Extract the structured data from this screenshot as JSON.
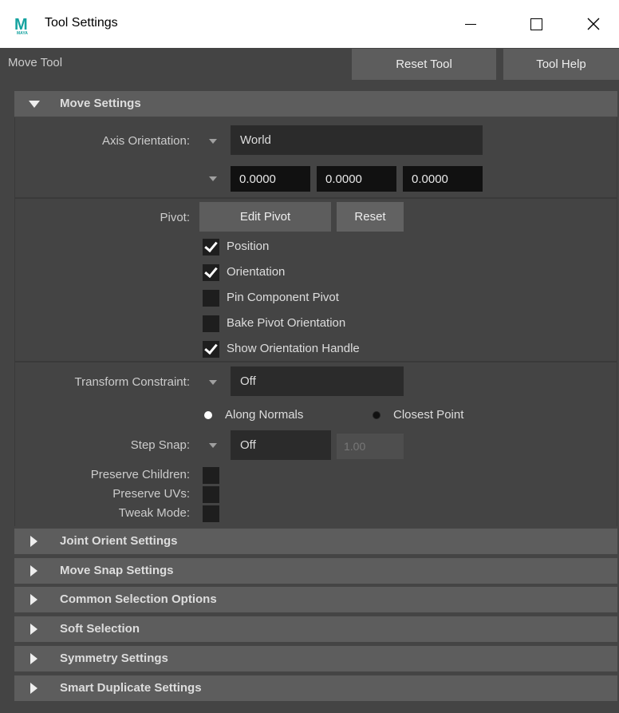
{
  "window": {
    "title": "Tool Settings",
    "logo_letter": "M",
    "logo_sub": "MAYA"
  },
  "header": {
    "tool_name": "Move Tool",
    "reset_tool": "Reset Tool",
    "tool_help": "Tool Help"
  },
  "move_settings": {
    "title": "Move Settings",
    "axis_orientation_label": "Axis Orientation:",
    "axis_orientation_value": "World",
    "axis_values": [
      "0.0000",
      "0.0000",
      "0.0000"
    ],
    "pivot_label": "Pivot:",
    "edit_pivot": "Edit Pivot",
    "reset": "Reset",
    "checks": [
      {
        "label": "Position",
        "checked": true
      },
      {
        "label": "Orientation",
        "checked": true
      },
      {
        "label": "Pin Component Pivot",
        "checked": false
      },
      {
        "label": "Bake Pivot Orientation",
        "checked": false
      },
      {
        "label": "Show Orientation Handle",
        "checked": true
      }
    ],
    "transform_constraint_label": "Transform Constraint:",
    "transform_constraint_value": "Off",
    "radio_along_normals": "Along Normals",
    "radio_closest_point": "Closest Point",
    "step_snap_label": "Step Snap:",
    "step_snap_value": "Off",
    "step_snap_amount": "1.00",
    "preserve_children_label": "Preserve Children:",
    "preserve_uvs_label": "Preserve UVs:",
    "tweak_mode_label": "Tweak Mode:"
  },
  "collapsed_sections": [
    "Joint Orient Settings",
    "Move Snap Settings",
    "Common Selection Options",
    "Soft Selection",
    "Symmetry Settings",
    "Smart Duplicate Settings"
  ]
}
